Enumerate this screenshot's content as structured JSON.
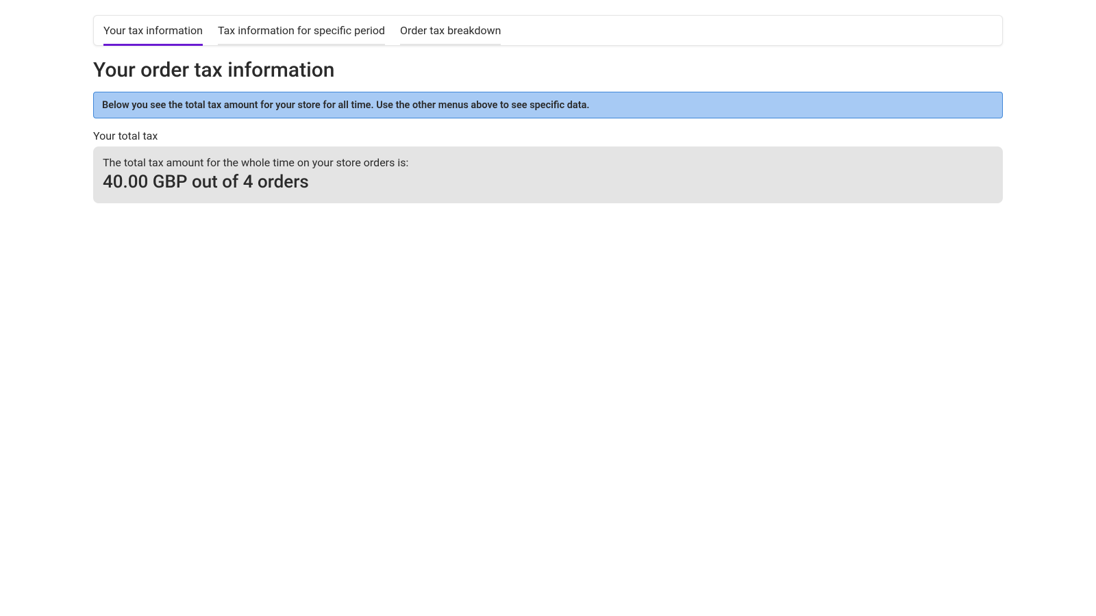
{
  "tabs": {
    "items": [
      {
        "label": "Your tax information",
        "active": true
      },
      {
        "label": "Tax information for specific period",
        "active": false
      },
      {
        "label": "Order tax breakdown",
        "active": false
      }
    ]
  },
  "page": {
    "title": "Your order tax information"
  },
  "banner": {
    "text": "Below you see the total tax amount for your store for all time. Use the other menus above to see specific data."
  },
  "section": {
    "label": "Your total tax"
  },
  "summary": {
    "description": "The total tax amount for the whole time on your store orders is:",
    "amount_line": "40.00 GBP out of 4 orders"
  }
}
